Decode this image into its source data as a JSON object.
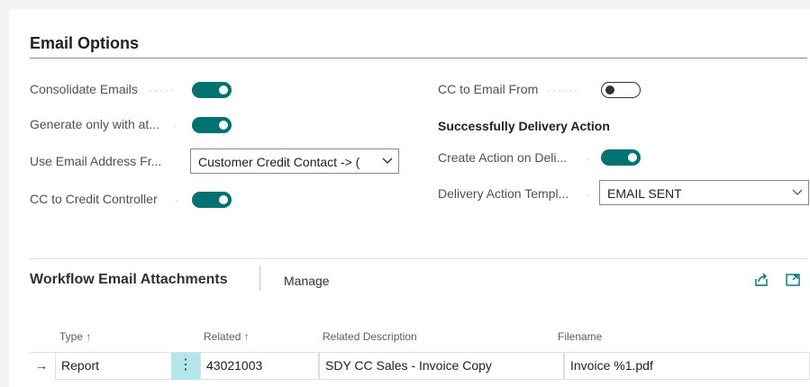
{
  "email_options": {
    "title": "Email Options",
    "left_fields": [
      {
        "label": "Consolidate Emails",
        "state": "on"
      },
      {
        "label": "Generate only with at...",
        "state": "on"
      },
      {
        "label": "Use Email Address Fr...",
        "value": "Customer Credit Contact -> (",
        "chevron": "chevron-down-icon"
      },
      {
        "label": "CC to Credit Controller",
        "state": "on"
      }
    ],
    "cc_email_from": {
      "label": "CC to Email From",
      "state": "off"
    },
    "delivery_heading": "Successfully Delivery Action",
    "create_action": {
      "label": "Create Action on Deli...",
      "state": "on"
    },
    "delivery_template": {
      "label": "Delivery Action Templ...",
      "value": "EMAIL SENT",
      "chevron": "chevron-down-icon"
    }
  },
  "attachments_part": {
    "title": "Workflow Email Attachments",
    "manage_label": "Manage",
    "icons": [
      "share-icon",
      "expand-icon"
    ],
    "columns": [
      "Type ↑",
      "Related ↑",
      "Related Description",
      "Filename"
    ],
    "rows": [
      {
        "arrow": "→",
        "type": "Report",
        "menu": "⋮",
        "related": "43021003",
        "related_description": "SDY CC Sales - Invoice Copy",
        "filename": "Invoice %1.pdf"
      }
    ]
  },
  "colors": {
    "toggle_on": "#00726f",
    "row_menu": "#b5e6ec",
    "accent": "#00726f"
  }
}
